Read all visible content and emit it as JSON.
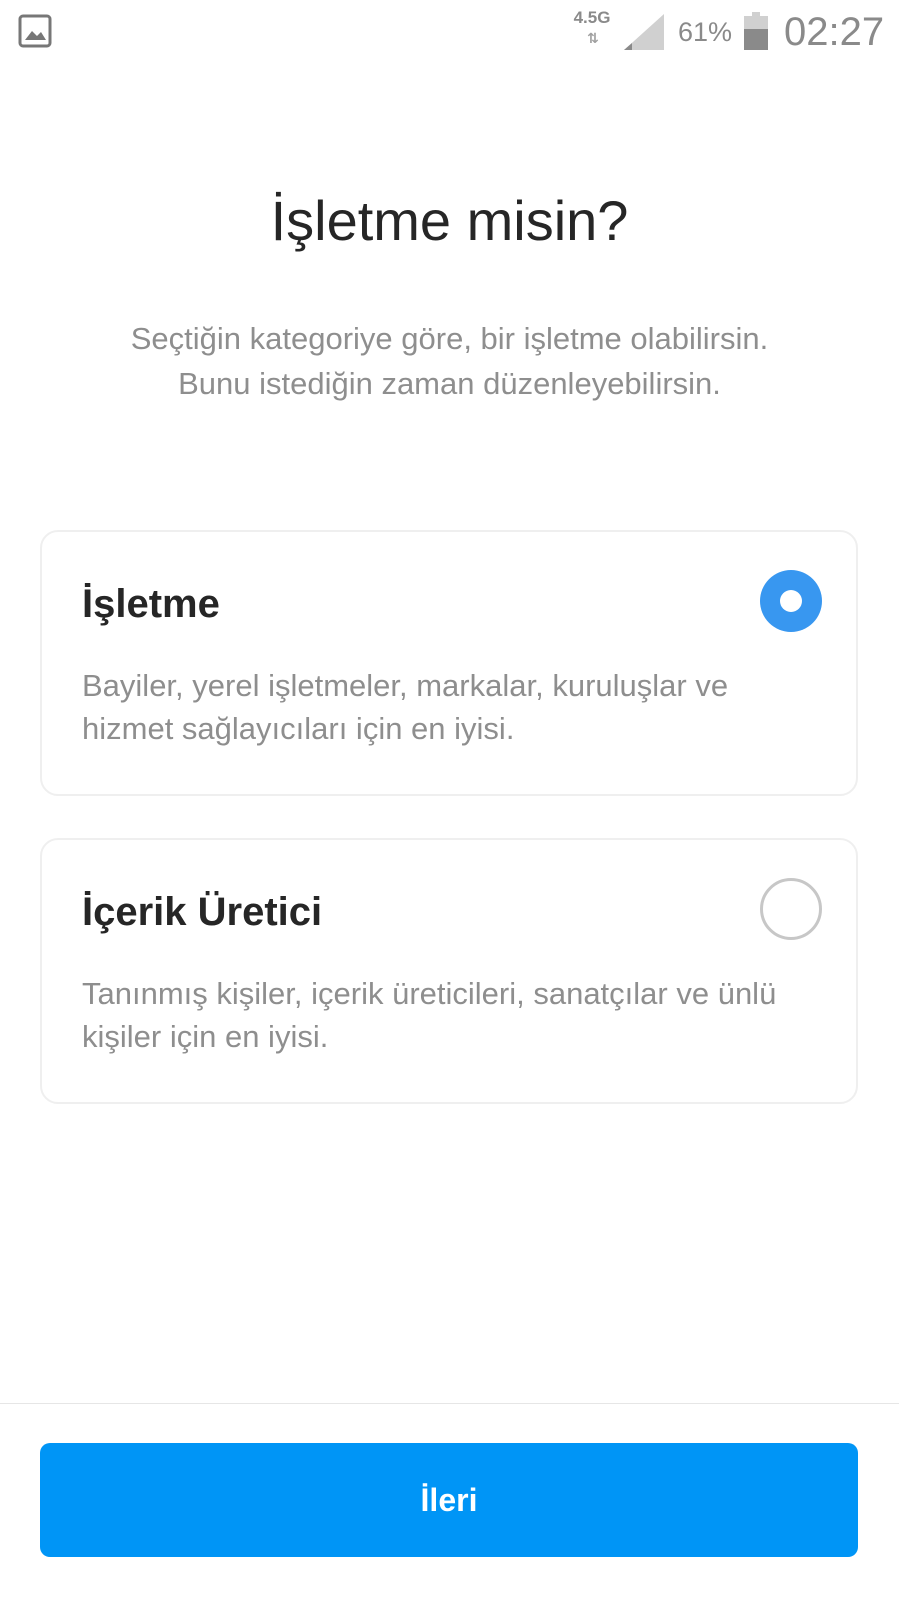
{
  "status_bar": {
    "left_icon": "gallery-icon",
    "network_type": "4.5G",
    "network_activity_icon": "data-arrows-icon",
    "signal_icon": "signal-icon",
    "battery_percent": "61%",
    "battery_icon": "battery-icon",
    "time": "02:27"
  },
  "header": {
    "title": "İşletme misin?",
    "subtitle_line1": "Seçtiğin kategoriye göre, bir işletme olabilirsin.",
    "subtitle_line2": "Bunu istediğin zaman düzenleyebilirsin."
  },
  "options": [
    {
      "title": "İşletme",
      "description": "Bayiler, yerel işletmeler, markalar, kuruluşlar ve hizmet sağlayıcıları için en iyisi.",
      "selected": true
    },
    {
      "title": "İçerik Üretici",
      "description": "Tanınmış kişiler, içerik üreticileri, sanatçılar ve ünlü kişiler için en iyisi.",
      "selected": false
    }
  ],
  "footer": {
    "next_label": "İleri"
  },
  "colors": {
    "accent": "#0095f6",
    "radio_selected": "#3897f0",
    "primary_text": "#262626",
    "secondary_text": "#8e8e8e",
    "card_border": "#efefef"
  }
}
